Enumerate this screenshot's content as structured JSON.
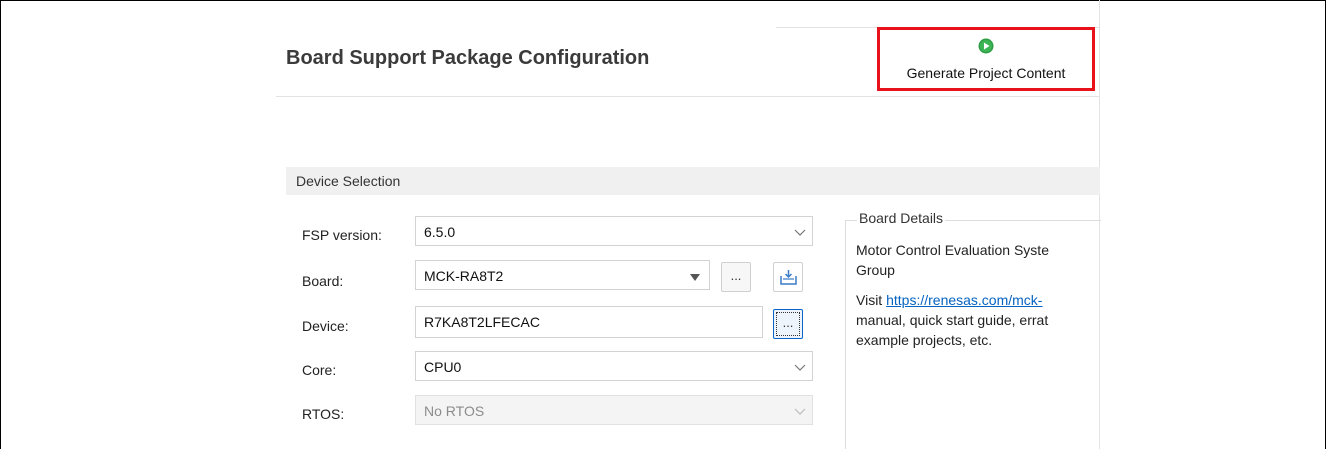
{
  "header": {
    "title": "Board Support Package Configuration",
    "generate_button_label": "Generate Project Content"
  },
  "section": {
    "title": "Device Selection"
  },
  "form": {
    "fsp_version": {
      "label": "FSP version:",
      "value": "6.5.0"
    },
    "board": {
      "label": "Board:",
      "value": "MCK-RA8T2",
      "browse_label": "..."
    },
    "device": {
      "label": "Device:",
      "value": "R7KA8T2LFECAC",
      "browse_label": "..."
    },
    "core": {
      "label": "Core:",
      "value": "CPU0"
    },
    "rtos": {
      "label": "RTOS:",
      "value": "No RTOS",
      "disabled": true
    }
  },
  "board_details": {
    "title": "Board Details",
    "line1": "Motor Control Evaluation Syste",
    "line2": "Group",
    "visit_prefix": "Visit ",
    "link": "https://renesas.com/mck-",
    "line4": "manual, quick start guide, errat",
    "line5": "example projects, etc."
  },
  "colors": {
    "highlight_border": "#e8121b",
    "link": "#0563c1",
    "run_icon": "#2e9e44"
  }
}
